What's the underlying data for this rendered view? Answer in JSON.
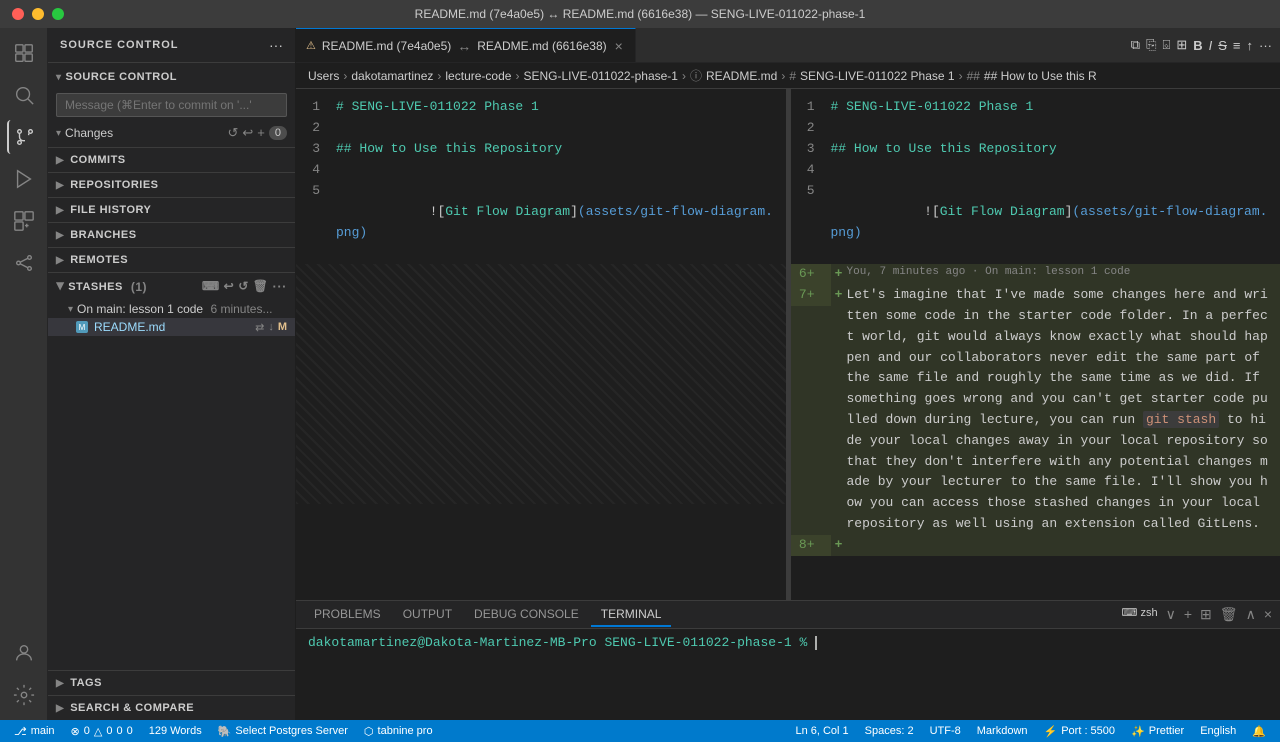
{
  "titlebar": {
    "title": "README.md (7e4a0e5) ↔ README.md (6616e38) — SENG-LIVE-011022-phase-1"
  },
  "sidebar": {
    "header": "SOURCE CONTROL",
    "more_label": "···",
    "source_control_label": "SOURCE CONTROL",
    "message_placeholder": "Message (⌘Enter to commit on '...'",
    "changes_label": "Changes",
    "changes_count": "0",
    "commits_label": "COMMITS",
    "repositories_label": "REPOSITORIES",
    "file_history_label": "FILE HISTORY",
    "branches_label": "BRANCHES",
    "remotes_label": "REMOTES",
    "stashes_label": "STASHES",
    "stashes_count": "1",
    "stash_entry_label": "On main: lesson 1 code",
    "stash_entry_time": "6 minutes...",
    "stash_file": "README.md",
    "tags_label": "TAGS",
    "search_compare_label": "SEARCH & COMPARE"
  },
  "editor": {
    "tab_left_icon": "M",
    "tab_left_label": "README.md (7e4a0e5)",
    "tab_arrow": "↔",
    "tab_right_label": "README.md (6616e38)",
    "breadcrumb_users": "Users",
    "breadcrumb_user": "dakotamartinez",
    "breadcrumb_lecture": "lecture-code",
    "breadcrumb_repo": "SENG-LIVE-011022-phase-1",
    "breadcrumb_file": "README.md",
    "breadcrumb_section": "SENG-LIVE-011022 Phase 1",
    "breadcrumb_heading": "## How to Use this R"
  },
  "left_pane": {
    "lines": [
      {
        "num": "1",
        "content": "# SENG-LIVE-011022 Phase 1",
        "type": "heading"
      },
      {
        "num": "2",
        "content": "",
        "type": "blank"
      },
      {
        "num": "3",
        "content": "## How to Use this Repository",
        "type": "heading2"
      },
      {
        "num": "4",
        "content": "",
        "type": "blank"
      },
      {
        "num": "5",
        "content": "![Git Flow Diagram](assets/git-flow-diagram.png)",
        "type": "image"
      }
    ]
  },
  "right_pane": {
    "lines": [
      {
        "num": "1",
        "content": "# SENG-LIVE-011022 Phase 1",
        "type": "heading"
      },
      {
        "num": "2",
        "content": "",
        "type": "blank"
      },
      {
        "num": "3",
        "content": "## How to Use this Repository",
        "type": "heading2"
      },
      {
        "num": "4",
        "content": "",
        "type": "blank"
      },
      {
        "num": "5",
        "content": "![Git Flow Diagram](assets/git-flow-diagram.png)",
        "type": "image"
      }
    ],
    "added_lines": [
      {
        "num": "6+",
        "content": "You, 7 minutes ago · On main: lesson 1 code",
        "type": "annotation"
      },
      {
        "num": "7+",
        "content": "Let's imagine that I've made some changes here and written some code in the starter code folder. In a perfect world, git would always know exactly what should happen and our collaborators never edit the same part of the same file and roughly the same time as we did. If something goes wrong and you can't get starter code pulled down during lecture, you can run `git stash` to hide your local changes away in your local repository so that they don't interfere with any potential changes made by your lecturer to the same file. I'll show you how you can access those stashed changes in your local repository as well using an extension called GitLens.",
        "type": "added"
      },
      {
        "num": "8+",
        "content": "",
        "type": "blank"
      }
    ]
  },
  "terminal": {
    "tabs": [
      "PROBLEMS",
      "OUTPUT",
      "DEBUG CONSOLE",
      "TERMINAL"
    ],
    "active_tab": "TERMINAL",
    "shell": "zsh",
    "prompt": "dakotamartinez@Dakota-Martinez-MB-Pro SENG-LIVE-011022-phase-1 % "
  },
  "status_bar": {
    "branch": "main",
    "errors": "0",
    "warnings": "0",
    "infos": "0",
    "hints": "0",
    "words": "129 Words",
    "server": "Select Postgres Server",
    "tabnine": "tabnine pro",
    "position": "Ln 6, Col 1",
    "spaces": "Spaces: 2",
    "encoding": "UTF-8",
    "language": "Markdown",
    "port": "Port : 5500",
    "prettier": "Prettier",
    "locale": "English"
  }
}
